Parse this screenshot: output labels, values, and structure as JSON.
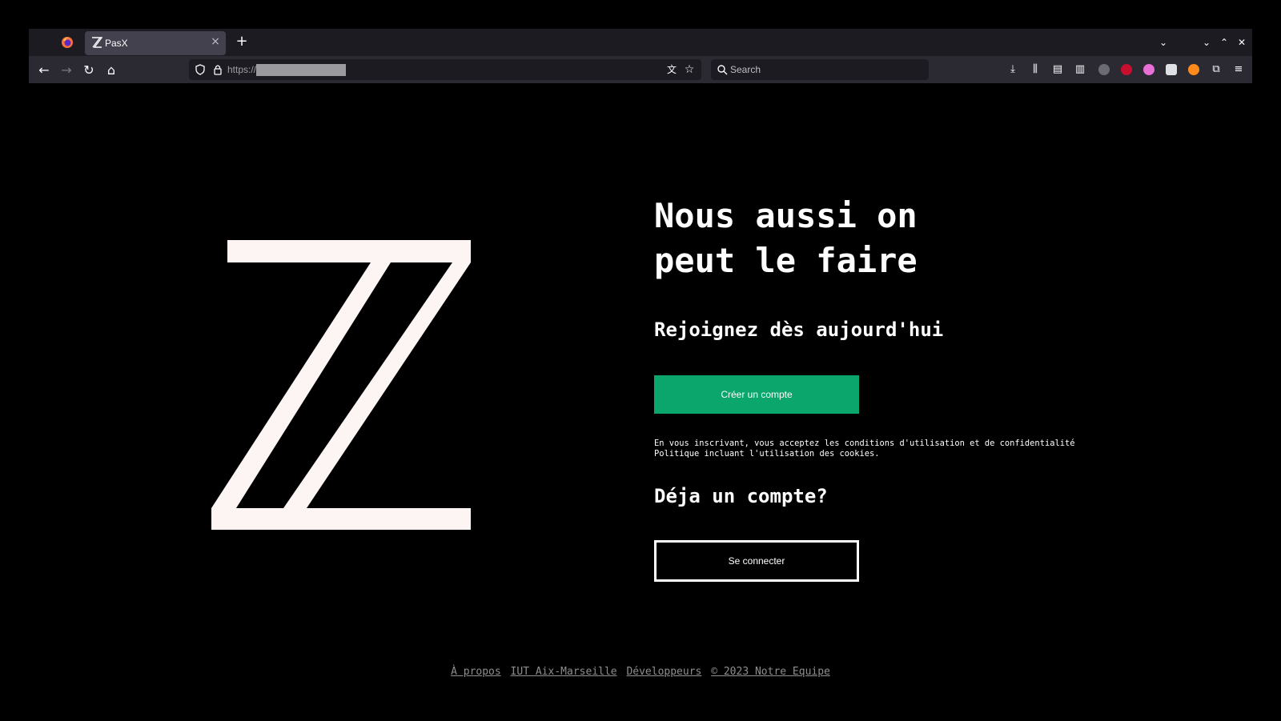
{
  "browser": {
    "tab_title": "PasX",
    "new_tab_symbol": "+",
    "tab_close_symbol": "×",
    "url_prefix": "https://",
    "search_placeholder": "Search"
  },
  "hero": {
    "line1": "Nous aussi on",
    "line2": "peut le faire"
  },
  "signup": {
    "subtitle": "Rejoignez dès aujourd'hui",
    "create_button": "Créer un compte",
    "terms_line1": "En vous inscrivant, vous acceptez les conditions d'utilisation et de confidentialité",
    "terms_line2": "Politique incluant l'utilisation des cookies."
  },
  "login": {
    "heading": "Déja un compte?",
    "button": "Se connecter"
  },
  "footer": {
    "links": [
      "À propos",
      "IUT Aix-Marseille",
      "Développeurs",
      "© 2023 Notre Equipe"
    ]
  },
  "colors": {
    "background": "#000000",
    "accent_green": "#0aa66b",
    "logo_fill": "#fdf5f3",
    "footer_link": "#8e8e8e"
  },
  "icons": [
    "firefox-icon",
    "back-arrow-icon",
    "forward-arrow-icon",
    "reload-icon",
    "home-icon",
    "shield-icon",
    "lock-icon",
    "translate-icon",
    "star-icon",
    "search-icon",
    "download-icon",
    "library-icon",
    "sidebar-icon",
    "menu-icon"
  ]
}
